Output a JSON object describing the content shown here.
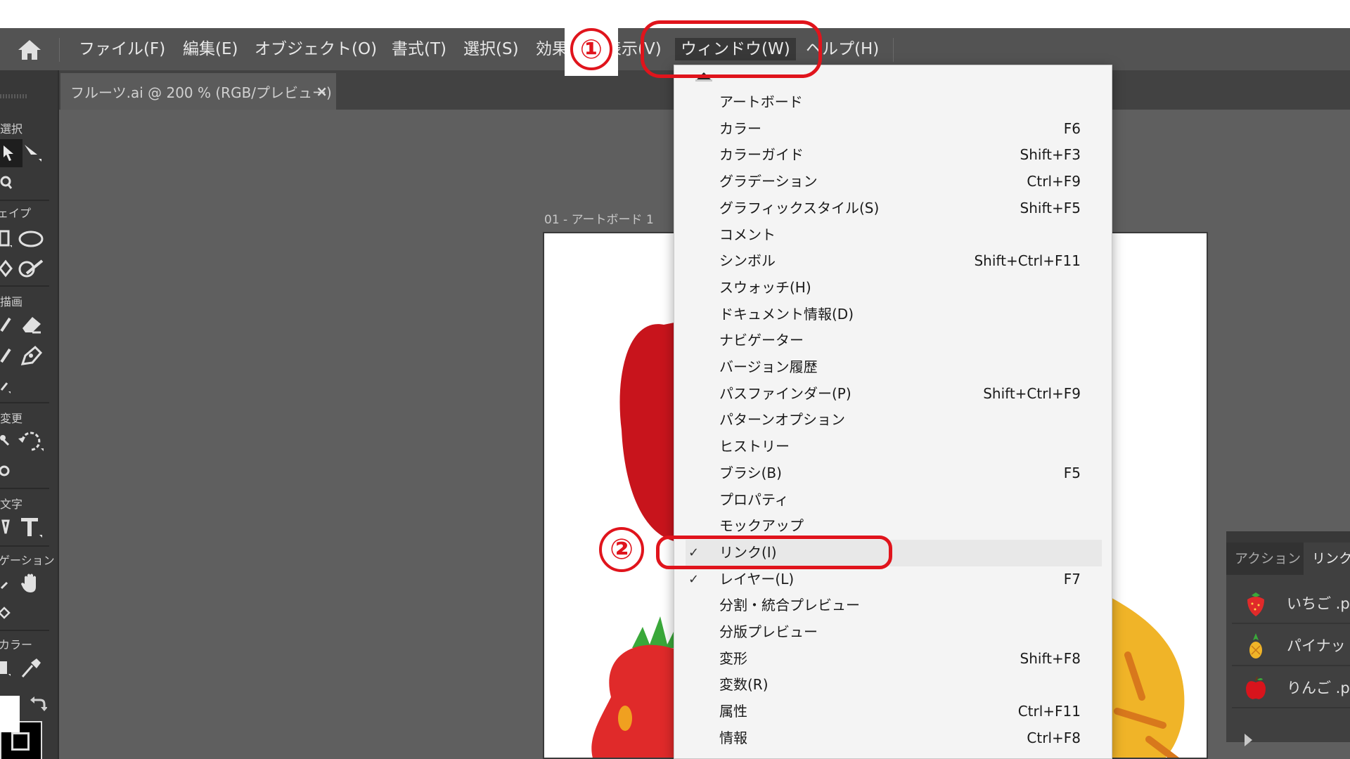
{
  "menubar": {
    "items": [
      {
        "label": "ファイル(F)"
      },
      {
        "label": "編集(E)"
      },
      {
        "label": "オブジェクト(O)"
      },
      {
        "label": "書式(T)"
      },
      {
        "label": "選択(S)"
      },
      {
        "label": "効果"
      },
      {
        "label": "表示(V)"
      },
      {
        "label": "ウィンドウ(W)"
      },
      {
        "label": "ヘルプ(H)"
      }
    ]
  },
  "document_tab": {
    "title": "フルーツ.ai @ 200 % (RGB/プレビュー)",
    "close": "×"
  },
  "artboard": {
    "label": "01 - アートボード 1"
  },
  "toolbar": {
    "sections": [
      "選択",
      "ェイプ",
      "描画",
      "変更",
      "文字",
      "ゲーション",
      "カラー"
    ]
  },
  "window_menu": {
    "items": [
      {
        "label": "アートボード",
        "shortcut": "",
        "checked": false
      },
      {
        "label": "カラー",
        "shortcut": "F6",
        "checked": false
      },
      {
        "label": "カラーガイド",
        "shortcut": "Shift+F3",
        "checked": false
      },
      {
        "label": "グラデーション",
        "shortcut": "Ctrl+F9",
        "checked": false
      },
      {
        "label": "グラフィックスタイル(S)",
        "shortcut": "Shift+F5",
        "checked": false
      },
      {
        "label": "コメント",
        "shortcut": "",
        "checked": false
      },
      {
        "label": "シンボル",
        "shortcut": "Shift+Ctrl+F11",
        "checked": false
      },
      {
        "label": "スウォッチ(H)",
        "shortcut": "",
        "checked": false
      },
      {
        "label": "ドキュメント情報(D)",
        "shortcut": "",
        "checked": false
      },
      {
        "label": "ナビゲーター",
        "shortcut": "",
        "checked": false
      },
      {
        "label": "バージョン履歴",
        "shortcut": "",
        "checked": false
      },
      {
        "label": "パスファインダー(P)",
        "shortcut": "Shift+Ctrl+F9",
        "checked": false
      },
      {
        "label": "パターンオプション",
        "shortcut": "",
        "checked": false
      },
      {
        "label": "ヒストリー",
        "shortcut": "",
        "checked": false
      },
      {
        "label": "ブラシ(B)",
        "shortcut": "F5",
        "checked": false
      },
      {
        "label": "プロパティ",
        "shortcut": "",
        "checked": false
      },
      {
        "label": "モックアップ",
        "shortcut": "",
        "checked": false
      },
      {
        "label": "リンク(I)",
        "shortcut": "",
        "checked": true
      },
      {
        "label": "レイヤー(L)",
        "shortcut": "F7",
        "checked": true
      },
      {
        "label": "分割・統合プレビュー",
        "shortcut": "",
        "checked": false
      },
      {
        "label": "分版プレビュー",
        "shortcut": "",
        "checked": false
      },
      {
        "label": "変形",
        "shortcut": "Shift+F8",
        "checked": false
      },
      {
        "label": "変数(R)",
        "shortcut": "",
        "checked": false
      },
      {
        "label": "属性",
        "shortcut": "Ctrl+F11",
        "checked": false
      },
      {
        "label": "情報",
        "shortcut": "Ctrl+F8",
        "checked": false
      }
    ],
    "highlighted": "リンク(I)"
  },
  "links_panel": {
    "tabs": [
      "アクション",
      "リンク"
    ],
    "items": [
      {
        "name": "いちご .p"
      },
      {
        "name": "パイナッ"
      },
      {
        "name": "りんご .p"
      }
    ]
  },
  "annotations": {
    "step1": "①",
    "step2": "②"
  },
  "colors": {
    "menubar_bg": "#535353",
    "canvas_bg": "#5f5f5f",
    "annotation_red": "#e0141c"
  }
}
